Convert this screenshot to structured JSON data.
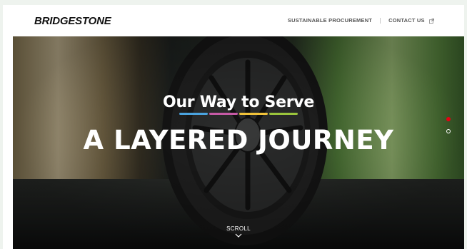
{
  "header": {
    "logo_text": "BRIDGESTONE",
    "nav": [
      {
        "label": "SUSTAINABLE PROCUREMENT"
      },
      {
        "label": "CONTACT US",
        "icon": "external-link-icon"
      }
    ]
  },
  "hero": {
    "tagline": "Our Way to Serve",
    "tagline_bar_colors": [
      "#4aa3df",
      "#c65aa6",
      "#f0c23a",
      "#9ac43c"
    ],
    "headline": "A LAYERED JOURNEY",
    "scroll_label": "SCROLL",
    "scroll_icon": "chevron-down-icon",
    "slide_dots": [
      {
        "active": true
      },
      {
        "active": false
      }
    ]
  },
  "colors": {
    "accent": "#e60012",
    "nav_text": "#555555",
    "text_on_hero": "#ffffff"
  }
}
